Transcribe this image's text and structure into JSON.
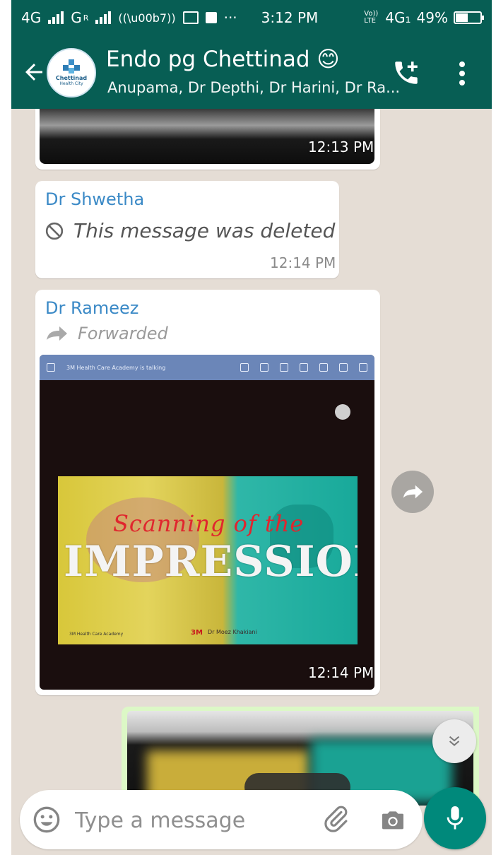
{
  "status_bar": {
    "network_left": "4G",
    "network_mid": "G",
    "network_mid_sup": "R",
    "more": "···",
    "time": "3:12 PM",
    "volte": "Vo)) LTE",
    "network_right": "4G₁",
    "battery_percent": "49%",
    "battery_level": 0.49
  },
  "chat_header": {
    "title": "Endo pg Chettinad 😊",
    "subtitle": "Anupama, Dr Depthi, Dr Harini, Dr Ra...",
    "avatar_name": "Chettinad",
    "avatar_sub": "Health City"
  },
  "messages": [
    {
      "type": "image",
      "time": "12:13 PM"
    },
    {
      "type": "deleted",
      "sender": "Dr Shwetha",
      "text": "This message was deleted",
      "time": "12:14 PM"
    },
    {
      "type": "forwarded_image",
      "sender": "Dr Rameez",
      "forwarded_label": "Forwarded",
      "time": "12:14 PM",
      "photo": {
        "meeting_bar_text": "3M Health Care Academy is talking",
        "slide_script": "Scanning of the",
        "slide_title": "IMPRESSION",
        "footer_left": "3M Health Care Academy",
        "brand": "3M",
        "footer_right": "Dr Moez Khakiani"
      }
    },
    {
      "type": "outgoing_image"
    }
  ],
  "composer": {
    "placeholder": "Type a message"
  },
  "colors": {
    "header": "#075e54",
    "chat_bg": "#e5ddd5",
    "sender_name": "#3a89c6",
    "outgoing_bubble": "#dcf8c6",
    "mic_button": "#00897b"
  },
  "icons": [
    "back-arrow-icon",
    "add-call-icon",
    "more-vert-icon",
    "block-icon",
    "forward-arrow-icon",
    "share-icon",
    "double-chevron-down-icon",
    "emoji-icon",
    "paperclip-icon",
    "camera-icon",
    "mic-icon"
  ]
}
